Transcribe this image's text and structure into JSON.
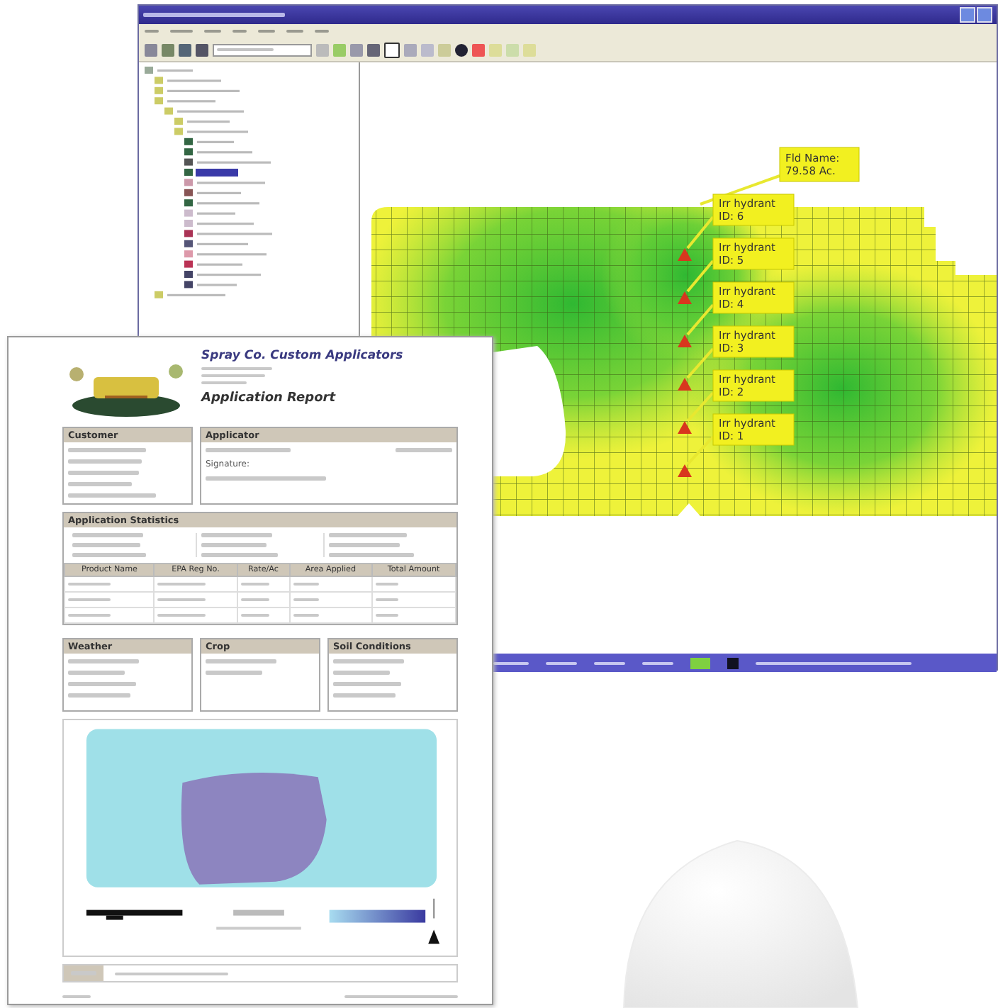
{
  "map_window": {
    "field_label": {
      "line1": "Fld Name:",
      "line2": "79.58 Ac."
    },
    "hydrants": [
      {
        "line1": "Irr hydrant",
        "line2": "ID: 6"
      },
      {
        "line1": "Irr hydrant",
        "line2": "ID: 5"
      },
      {
        "line1": "Irr hydrant",
        "line2": "ID: 4"
      },
      {
        "line1": "Irr hydrant",
        "line2": "ID: 3"
      },
      {
        "line1": "Irr hydrant",
        "line2": "ID: 2"
      },
      {
        "line1": "Irr hydrant",
        "line2": "ID: 1"
      }
    ]
  },
  "report": {
    "company": "Spray Co. Custom Applicators",
    "title": "Application Report",
    "customer": {
      "heading": "Customer"
    },
    "applicator": {
      "heading": "Applicator",
      "signature_label": "Signature:"
    },
    "statistics": {
      "heading": "Application Statistics"
    },
    "products": {
      "columns": [
        "Product Name",
        "EPA Reg No.",
        "Rate/Ac",
        "Area Applied",
        "Total Amount"
      ]
    },
    "conditions": [
      {
        "heading": "Weather"
      },
      {
        "heading": "Crop"
      },
      {
        "heading": "Soil Conditions"
      }
    ]
  }
}
